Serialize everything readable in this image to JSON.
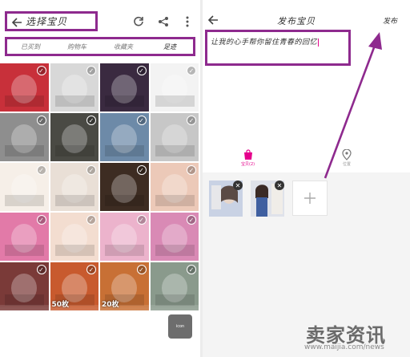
{
  "left": {
    "title": "选择宝贝",
    "tabs": [
      {
        "label": "已买到"
      },
      {
        "label": "购物车"
      },
      {
        "label": "收藏夹"
      },
      {
        "label": "足迹"
      }
    ],
    "cells": [
      {
        "color": "#c8303a"
      },
      {
        "color": "#d8d8d8"
      },
      {
        "color": "#3a2a40"
      },
      {
        "color": "#f3f3f3"
      },
      {
        "color": "#8e8e8e"
      },
      {
        "color": "#4a4a44"
      },
      {
        "color": "#6d8aa8"
      },
      {
        "color": "#c7c7c7"
      },
      {
        "color": "#f6efe8"
      },
      {
        "color": "#e9dfd6"
      },
      {
        "color": "#3d2c22"
      },
      {
        "color": "#ecc9b8"
      },
      {
        "color": "#e27aa8"
      },
      {
        "color": "#f3ddd0"
      },
      {
        "color": "#ecb3cc"
      },
      {
        "color": "#d98ab5"
      },
      {
        "color": "#7a3a38"
      },
      {
        "color": "#c85a2e",
        "text": "50枚"
      },
      {
        "color": "#c87035",
        "text": "20枚"
      },
      {
        "color": "#8a9a8c"
      }
    ],
    "float_label": "icon"
  },
  "right": {
    "title": "发布宝贝",
    "publish_label": "发布",
    "description": "让我的心手帮你留住青春的回忆",
    "actions": [
      {
        "label": "宝贝(2)"
      },
      {
        "label": "位置"
      }
    ],
    "thumbs": [
      {
        "color": "#c9d2e4"
      },
      {
        "color": "#dfe2ea"
      }
    ]
  },
  "watermark": {
    "title": "卖家资讯",
    "url": "www.maijia.com/news"
  },
  "colors": {
    "highlight": "#8e2a8e",
    "accent": "#e5008c"
  }
}
